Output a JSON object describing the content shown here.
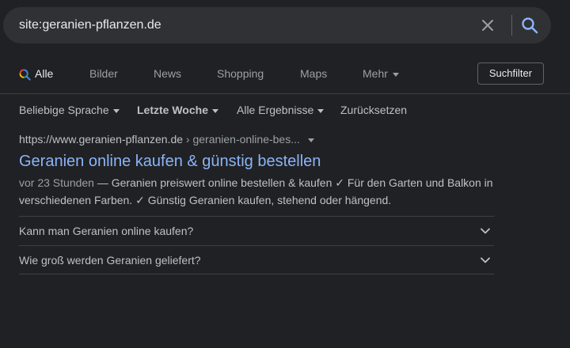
{
  "search": {
    "query": "site:geranien-pflanzen.de",
    "clear_icon": "close-icon",
    "submit_icon": "search-icon"
  },
  "tabs": [
    {
      "label": "Alle",
      "icon": "search-multicolor-icon",
      "active": true
    },
    {
      "label": "Bilder"
    },
    {
      "label": "News"
    },
    {
      "label": "Shopping"
    },
    {
      "label": "Maps"
    },
    {
      "label": "Mehr",
      "icon": "caret-down-icon"
    }
  ],
  "tools": {
    "suchfilter_label": "Suchfilter"
  },
  "filters": [
    {
      "label": "Beliebige Sprache",
      "has_dropdown": true
    },
    {
      "label": "Letzte Woche",
      "has_dropdown": true,
      "selected": true
    },
    {
      "label": "Alle Ergebnisse",
      "has_dropdown": true
    },
    {
      "label": "Zurücksetzen"
    }
  ],
  "result": {
    "url_host": "https://www.geranien-pflanzen.de",
    "url_path": " › geranien-online-bes...",
    "title": "Geranien online kaufen & günstig bestellen",
    "date": "vor 23 Stunden",
    "separator": " — ",
    "snippet": "Geranien preiswert online bestellen & kaufen ✓ Für den Garten und Balkon in verschiedenen Farben. ✓ Günstig Geranien kaufen, stehend oder hängend."
  },
  "faq": [
    {
      "question": "Kann man Geranien online kaufen?"
    },
    {
      "question": "Wie groß werden Geranien geliefert?"
    }
  ],
  "colors": {
    "background": "#202124",
    "searchbar": "#303134",
    "link": "#8ab4f8",
    "text": "#bdc1c6",
    "muted": "#9aa0a6",
    "divider": "#3c4043"
  }
}
